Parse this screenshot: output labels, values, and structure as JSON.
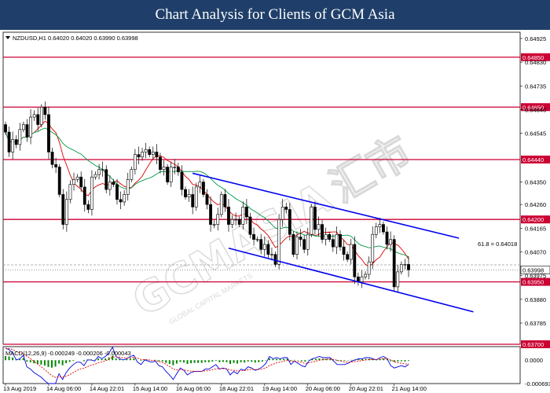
{
  "banner": {
    "title": "Chart Analysis for Clients of GCM Asia"
  },
  "watermark": {
    "brand": "GCMASIA",
    "cn": "汇市",
    "tagline": "GLOBAL CAPITAL MARKETS"
  },
  "chart_data": {
    "type": "candlestick",
    "symbol_header": "NZDUSD,H1  0.64020 0.64020 0.63990 0.63998",
    "ylim": [
      0.637,
      0.6495
    ],
    "y_ticks": [
      "0.64925",
      "0.64850",
      "0.64830",
      "0.64735",
      "0.64650",
      "0.64640",
      "0.64545",
      "0.64440",
      "0.64350",
      "0.64260",
      "0.64200",
      "0.64165",
      "0.64070",
      "0.63998",
      "0.63975",
      "0.63950",
      "0.63880",
      "0.63785",
      "0.63700"
    ],
    "x_ticks": [
      "13 Aug 2019",
      "14 Aug 06:00",
      "14 Aug 22:01",
      "15 Aug 14:00",
      "16 Aug 06:00",
      "18 Aug 22:01",
      "19 Aug 14:00",
      "20 Aug 06:00",
      "20 Aug 22:01",
      "21 Aug 14:00"
    ],
    "x_tick_index": [
      0,
      12,
      24,
      36,
      48,
      60,
      72,
      84,
      96,
      108
    ],
    "horizontal_levels": [
      {
        "value": 0.6485,
        "label": "0.64850",
        "color": "#cc0033"
      },
      {
        "value": 0.6465,
        "label": "0.64650",
        "color": "#cc0033"
      },
      {
        "value": 0.6444,
        "label": "0.64440",
        "color": "#cc0033"
      },
      {
        "value": 0.642,
        "label": "0.64200",
        "color": "#cc0033"
      },
      {
        "value": 0.6395,
        "label": "0.63950",
        "color": "#cc0033"
      },
      {
        "value": 0.637,
        "label": "0.63700",
        "color": "#cc0033"
      }
    ],
    "current_price": {
      "value": 0.63998,
      "label": "0.63998"
    },
    "fib_level": {
      "label": "61.8 = 0.64018",
      "value": 0.64018
    },
    "channel": {
      "color": "#0000ee",
      "upper": [
        {
          "i": 52,
          "price": 0.64385
        },
        {
          "i": 126,
          "price": 0.64125
        }
      ],
      "lower": [
        {
          "i": 62,
          "price": 0.64085
        },
        {
          "i": 130,
          "price": 0.6383
        }
      ]
    },
    "ma_fast_color": "#dd0000",
    "ma_slow_color": "#009944",
    "price_series": [
      0.6455,
      0.6447,
      0.6452,
      0.645,
      0.6456,
      0.6458,
      0.6453,
      0.6461,
      0.6462,
      0.6458,
      0.6465,
      0.6462,
      0.6447,
      0.6442,
      0.6441,
      0.643,
      0.6418,
      0.6428,
      0.6434,
      0.6436,
      0.6437,
      0.6433,
      0.6426,
      0.6424,
      0.6437,
      0.6438,
      0.644,
      0.644,
      0.6432,
      0.6435,
      0.6434,
      0.6428,
      0.6427,
      0.643,
      0.6436,
      0.644,
      0.6446,
      0.6445,
      0.6447,
      0.6448,
      0.6446,
      0.6447,
      0.6445,
      0.644,
      0.6441,
      0.6435,
      0.6441,
      0.6441,
      0.6439,
      0.6432,
      0.6429,
      0.643,
      0.6425,
      0.6433,
      0.6435,
      0.643,
      0.6426,
      0.6418,
      0.6418,
      0.6422,
      0.643,
      0.6425,
      0.6418,
      0.642,
      0.642,
      0.6418,
      0.6425,
      0.6421,
      0.6414,
      0.6412,
      0.6412,
      0.6408,
      0.641,
      0.6406,
      0.6406,
      0.6402,
      0.642,
      0.6425,
      0.6424,
      0.6414,
      0.6406,
      0.6413,
      0.6412,
      0.6408,
      0.6414,
      0.6425,
      0.6416,
      0.6418,
      0.6412,
      0.6414,
      0.6412,
      0.6409,
      0.6414,
      0.6409,
      0.6406,
      0.6404,
      0.641,
      0.6397,
      0.6395,
      0.6397,
      0.6398,
      0.6403,
      0.6414,
      0.6417,
      0.6418,
      0.6415,
      0.641,
      0.6412,
      0.6393,
      0.6399,
      0.6402,
      0.6402,
      0.63998
    ],
    "macd": {
      "label": "MACD(12,26,9) -0.000249 -0.000206 -0.000043",
      "ylim": [
        -0.00069,
        0.0004
      ],
      "y_ticks": [
        "0.0000",
        "-0.000693"
      ],
      "histogram": [
        0.00012,
        0.00011,
        8e-05,
        2e-05,
        3e-05,
        6e-05,
        -4e-05,
        -6e-05,
        -9e-05,
        -0.00011,
        -0.00013,
        -0.00016,
        -0.0002,
        -0.00022,
        -0.00019,
        -0.0001,
        -0.00015,
        -9e-05,
        -5e-05,
        -2e-05,
        -0.0,
        0.0,
        -3e-05,
        2e-05,
        2e-05,
        1e-05,
        5e-05,
        3e-05,
        5e-05,
        8e-05,
        0.00013,
        5e-05,
        3e-05,
        2e-05,
        3e-05,
        5e-05,
        6e-05,
        -0.0,
        -2e-05,
        2e-05,
        1e-05,
        -0.0,
        1e-05,
        -3e-05,
        -4e-05,
        -8e-05,
        -0.00011,
        -0.00015,
        -0.0001,
        -5e-05,
        -7e-05,
        -0.00011,
        -9e-05,
        -8e-05,
        -8e-05,
        -8e-05,
        -6e-05,
        -6e-05,
        -4e-05,
        -2e-05,
        -6e-05,
        -5e-05,
        -6e-05,
        -0.00011,
        -8e-05,
        -0.0001,
        -6e-05,
        -7e-05,
        -4e-05,
        -5e-05,
        -7e-05,
        -6e-05,
        -4e-05,
        -1e-05,
        5e-05,
        3e-05,
        4e-05,
        3e-05,
        4e-05,
        4e-05,
        -2e-05,
        1e-05,
        -1e-05,
        -3e-05,
        -4e-05,
        1e-05,
        3e-05,
        4e-05,
        5e-05,
        4e-05,
        4e-05,
        4e-05,
        1e-05,
        -2e-05,
        -2e-05,
        -2e-05,
        -1e-05,
        1e-05,
        2e-05,
        3e-05,
        3e-05,
        4e-05,
        4e-05,
        3e-05,
        2e-05,
        4e-05,
        5e-05,
        3e-05,
        -3e-05,
        -5e-05,
        -4e-05,
        -3e-05,
        -4e-05,
        -2e-05
      ]
    }
  }
}
